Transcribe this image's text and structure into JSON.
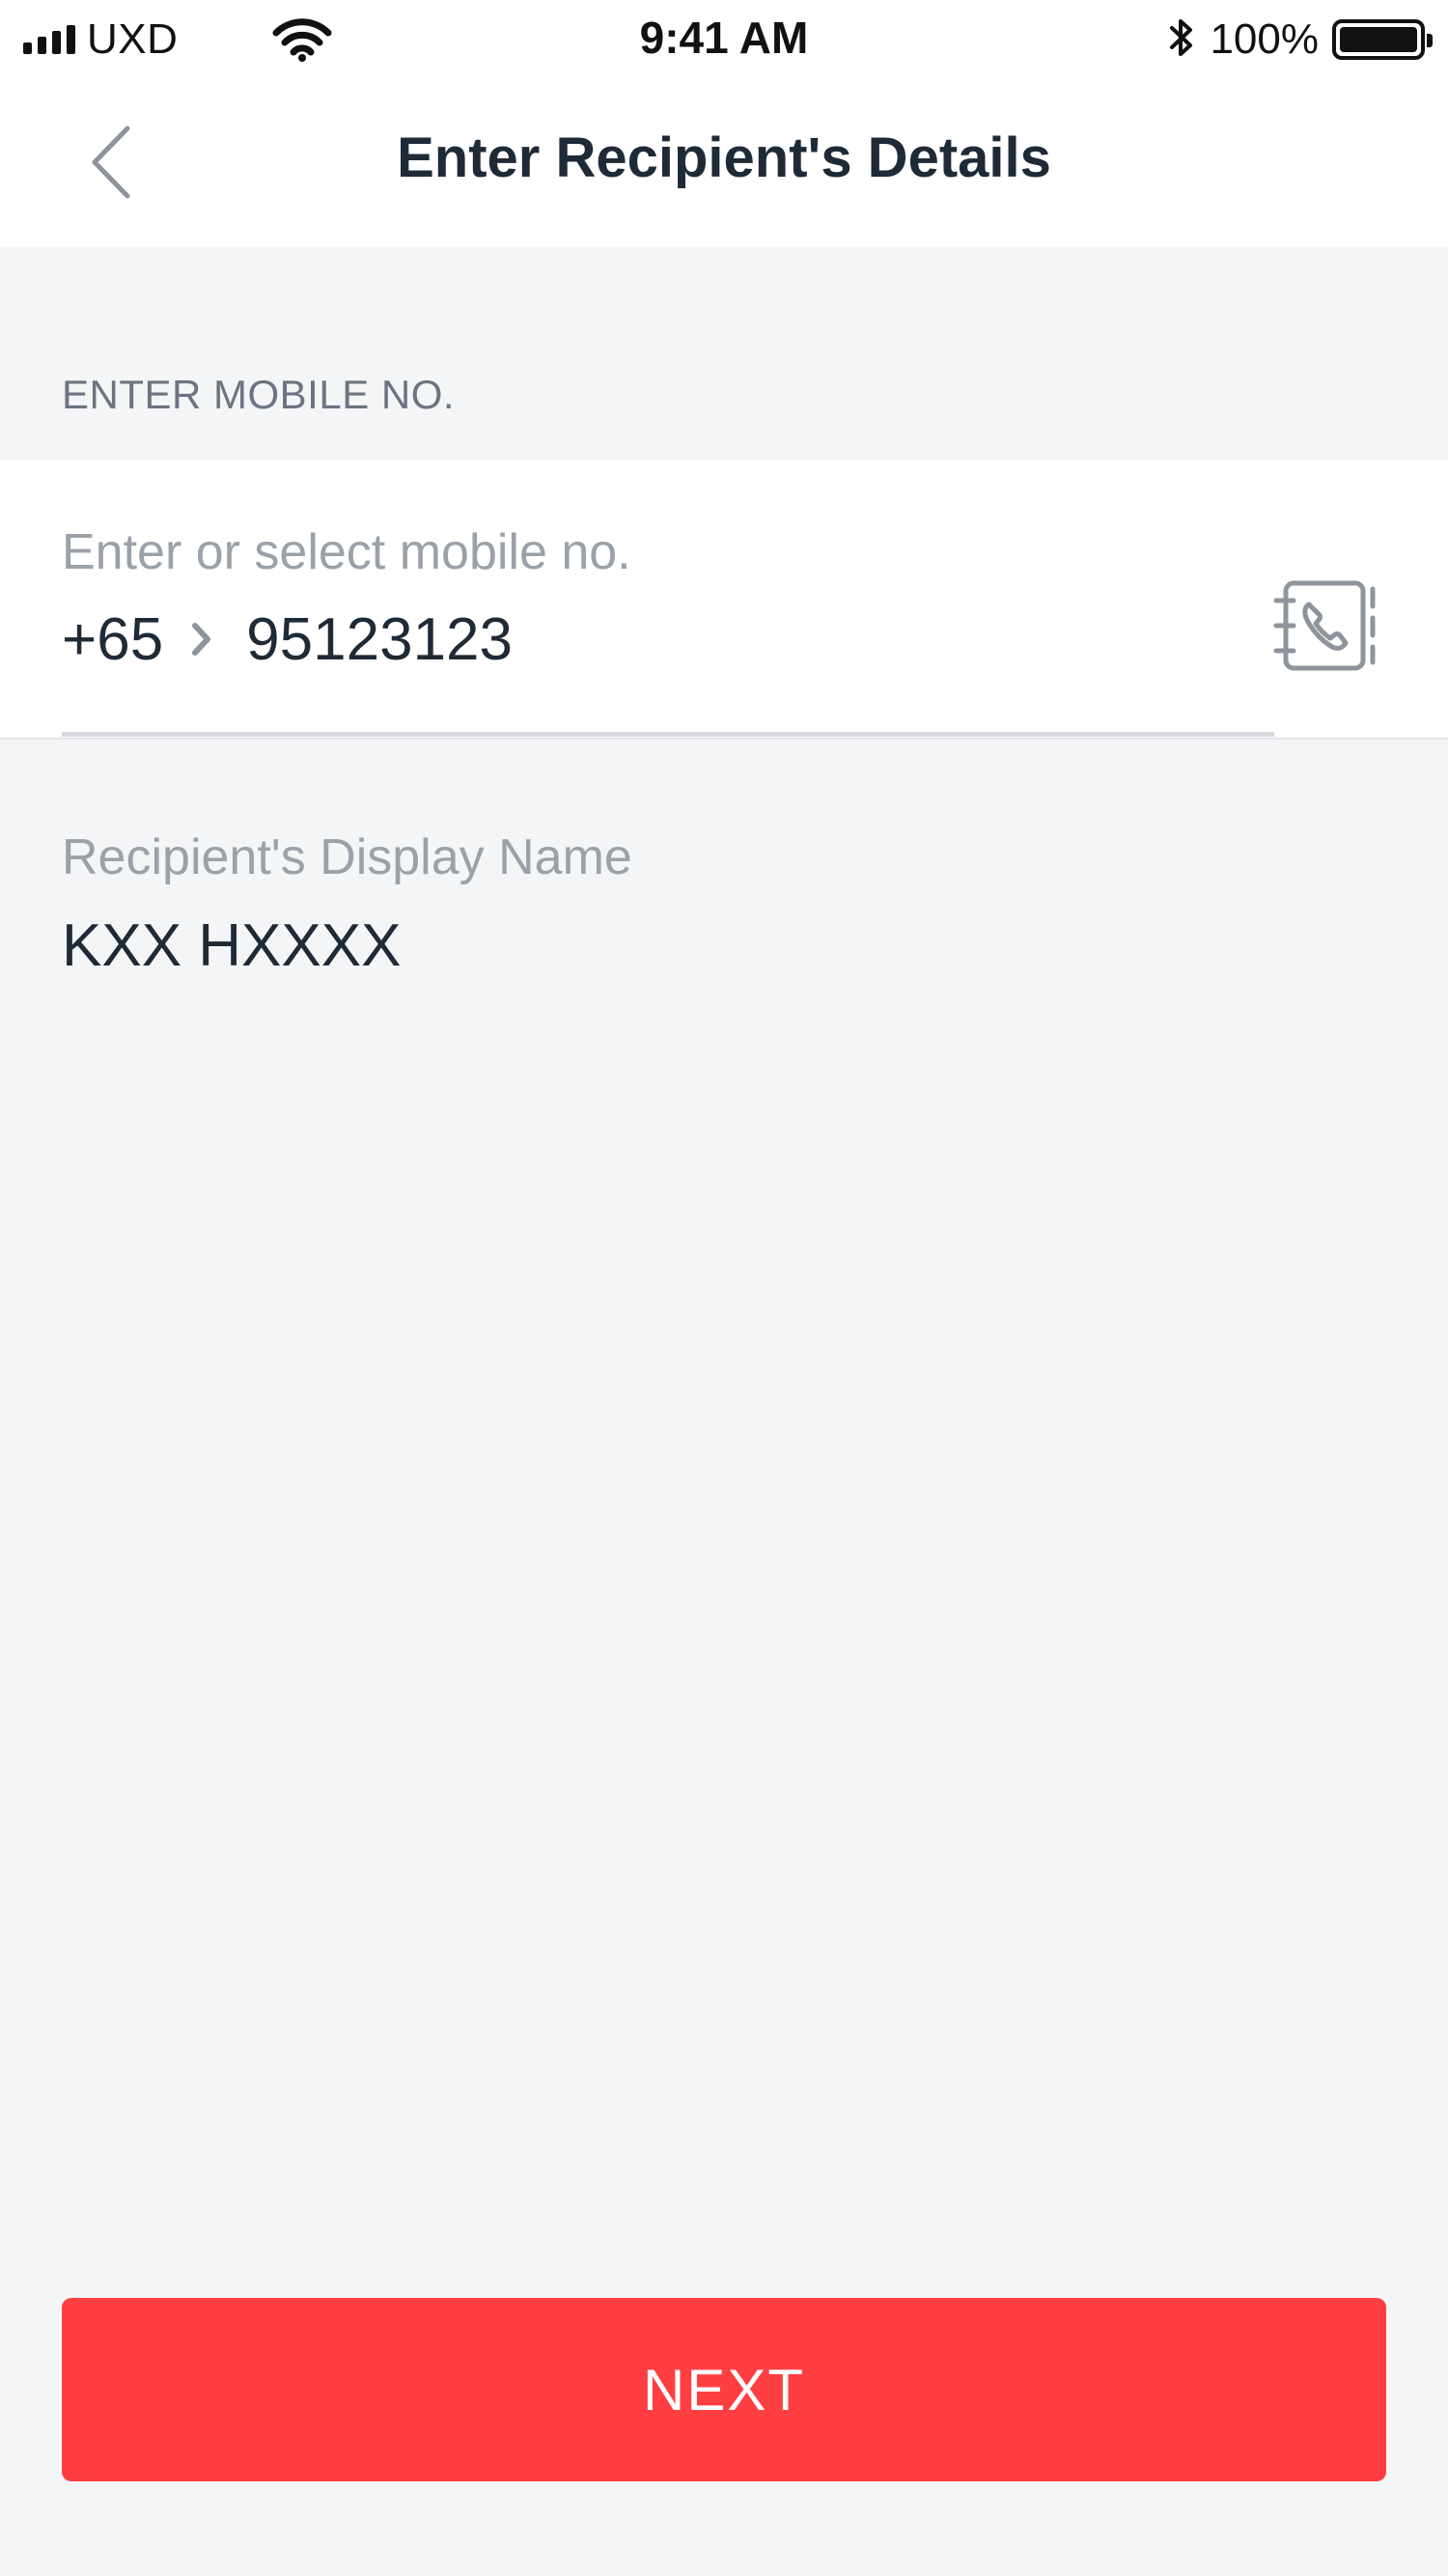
{
  "status_bar": {
    "carrier": "UXD",
    "time": "9:41 AM",
    "battery_percent": "100%",
    "battery_level": 1.0,
    "signal_bars": 4,
    "icons": [
      "signal-icon",
      "wifi-icon",
      "bluetooth-icon",
      "battery-icon"
    ]
  },
  "nav": {
    "title": "Enter Recipient's Details",
    "back_icon": "chevron-left-icon"
  },
  "mobile_section": {
    "label": "ENTER MOBILE NO.",
    "placeholder": "Enter or select mobile no.",
    "country_code": "+65",
    "number": "95123123",
    "contacts_icon": "address-book-phone-icon"
  },
  "display_name": {
    "label": "Recipient's Display Name",
    "value": "KXX HXXXX"
  },
  "actions": {
    "next_label": "NEXT"
  },
  "colors": {
    "accent": "#ff3e41",
    "background": "#f4f5f7",
    "text_primary": "#1f2a37",
    "text_secondary": "#9aa1a9"
  }
}
